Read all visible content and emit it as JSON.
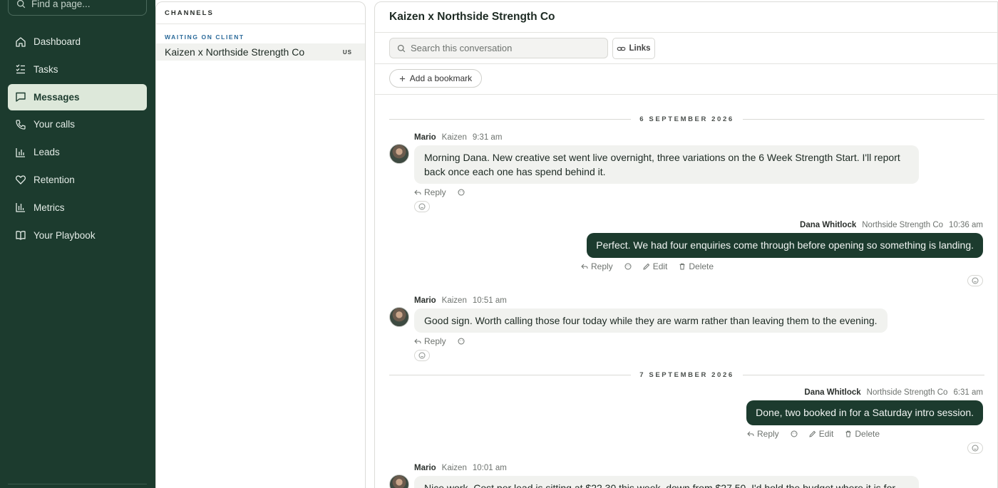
{
  "sidebar": {
    "search_placeholder": "Find a page...",
    "items": [
      {
        "label": "Dashboard",
        "icon": "home-icon"
      },
      {
        "label": "Tasks",
        "icon": "tasks-icon"
      },
      {
        "label": "Messages",
        "icon": "message-icon",
        "active": true
      },
      {
        "label": "Your calls",
        "icon": "phone-icon"
      },
      {
        "label": "Leads",
        "icon": "bar-chart-icon"
      },
      {
        "label": "Retention",
        "icon": "heart-icon"
      },
      {
        "label": "Metrics",
        "icon": "metrics-icon"
      },
      {
        "label": "Your Playbook",
        "icon": "book-icon"
      }
    ]
  },
  "channels": {
    "header": "CHANNELS",
    "group": "WAITING ON CLIENT",
    "items": [
      {
        "name": "Kaizen x Northside Strength Co",
        "tag": "US"
      }
    ]
  },
  "conversation": {
    "title": "Kaizen x Northside Strength Co",
    "search_placeholder": "Search this conversation",
    "links_label": "Links",
    "bookmark_label": "Add a bookmark",
    "dates": [
      "6 SEPTEMBER 2026",
      "7 SEPTEMBER 2026"
    ],
    "messages": [
      {
        "sender": "Mario",
        "org": "Kaizen",
        "time": "9:31 am",
        "text_line1": "Morning Dana. New creative set went live overnight, three variations on the 6 Week Strength Start. I'll report",
        "text_line2": "back once each one has spend behind it.",
        "direction": "in"
      },
      {
        "sender": "Dana Whitlock",
        "org": "Northside Strength Co",
        "time": "10:36 am",
        "text": "Perfect. We had four enquiries come through before opening so something is landing.",
        "direction": "out"
      },
      {
        "sender": "Mario",
        "org": "Kaizen",
        "time": "10:51 am",
        "text": "Good sign. Worth calling those four today while they are warm rather than leaving them to the evening.",
        "direction": "in"
      },
      {
        "sender": "Dana Whitlock",
        "org": "Northside Strength Co",
        "time": "6:31 am",
        "text": "Done, two booked in for a Saturday intro session.",
        "direction": "out"
      },
      {
        "sender": "Mario",
        "org": "Kaizen",
        "time": "10:01 am",
        "text": "Nice work. Cost per lead is sitting at $22.30 this week, down from $27.50. I'd hold the budget where it is for",
        "direction": "in"
      }
    ],
    "actions": {
      "reply": "Reply",
      "edit": "Edit",
      "delete": "Delete"
    }
  },
  "colors": {
    "sidebar_bg": "#1c3b2e",
    "active_nav_bg": "#dde8da",
    "outgoing_bubble": "#1c3b2e",
    "incoming_bubble": "#f1f2ef",
    "channel_group": "#2b6a9a"
  }
}
